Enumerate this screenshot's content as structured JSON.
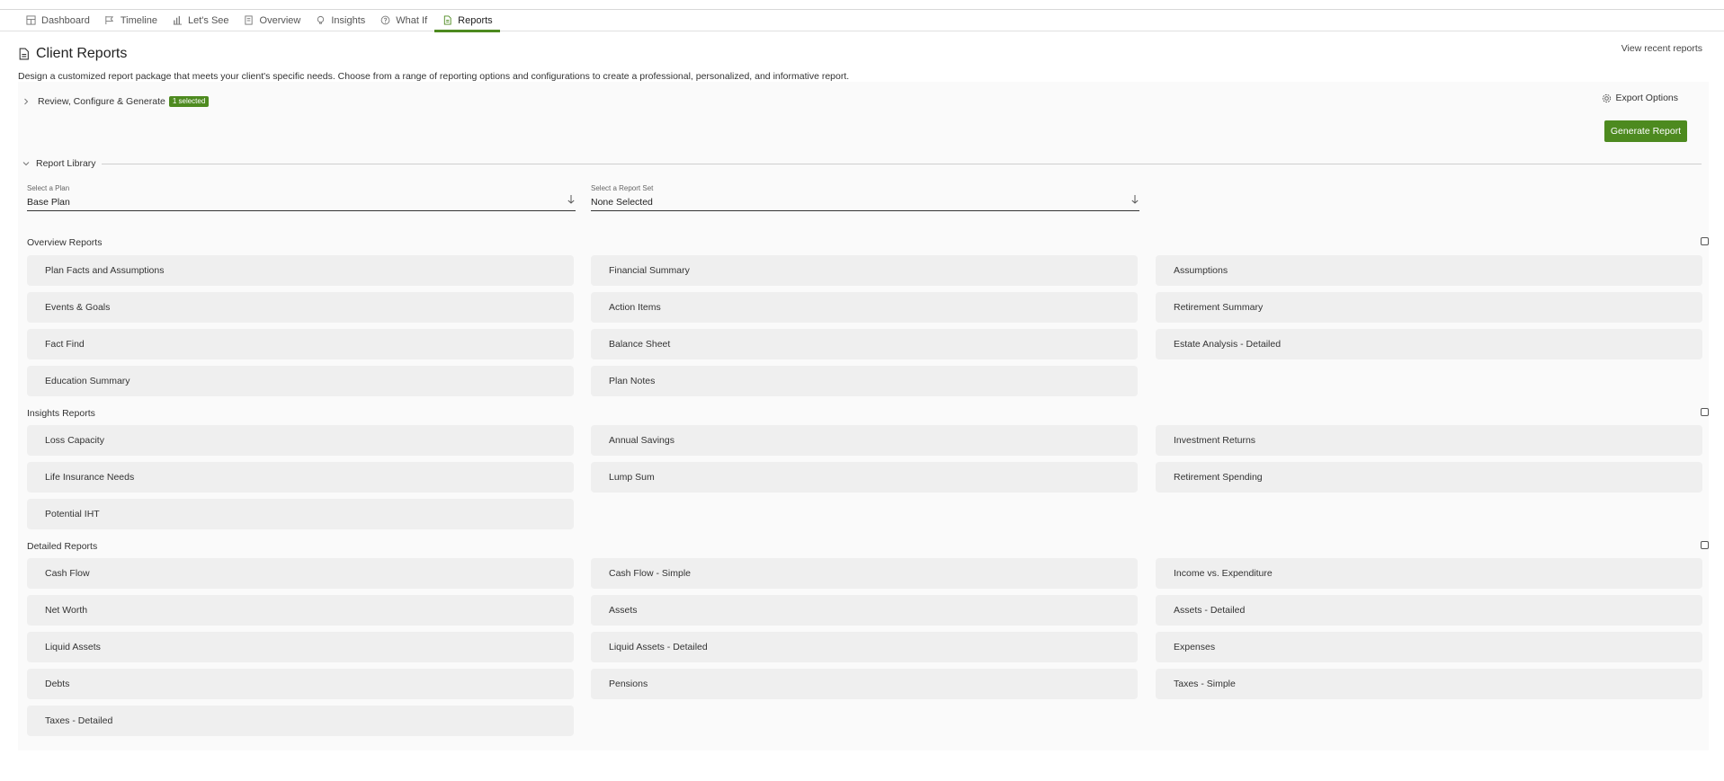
{
  "nav": {
    "tabs": [
      {
        "label": "Dashboard",
        "icon": "dashboard-icon"
      },
      {
        "label": "Timeline",
        "icon": "flag-icon"
      },
      {
        "label": "Let's See",
        "icon": "bar-chart-icon"
      },
      {
        "label": "Overview",
        "icon": "document-icon"
      },
      {
        "label": "Insights",
        "icon": "lightbulb-icon"
      },
      {
        "label": "What If",
        "icon": "question-icon"
      },
      {
        "label": "Reports",
        "icon": "report-icon"
      }
    ],
    "active": "Reports"
  },
  "header": {
    "title": "Client Reports",
    "view_recent": "View recent reports",
    "intro": "Design a customized report package that meets your client's specific needs. Choose from a range of reporting options and configurations to create a professional, personalized, and informative report."
  },
  "review": {
    "label": "Review, Configure & Generate",
    "badge": "1 selected"
  },
  "actions": {
    "export_options": "Export Options",
    "generate_report": "Generate Report"
  },
  "library": {
    "title": "Report Library",
    "plan_select": {
      "label": "Select a Plan",
      "value": "Base Plan"
    },
    "set_select": {
      "label": "Select a Report Set",
      "value": "None Selected"
    }
  },
  "sections": {
    "overview": {
      "title": "Overview Reports",
      "items": [
        "Plan Facts and Assumptions",
        "Financial Summary",
        "Assumptions",
        "Events & Goals",
        "Action Items",
        "Retirement Summary",
        "Fact Find",
        "Balance Sheet",
        "Estate Analysis - Detailed",
        "Education Summary",
        "Plan Notes"
      ]
    },
    "insights": {
      "title": "Insights Reports",
      "items": [
        "Loss Capacity",
        "Annual Savings",
        "Investment Returns",
        "Life Insurance Needs",
        "Lump Sum",
        "Retirement Spending",
        "Potential IHT"
      ]
    },
    "detailed": {
      "title": "Detailed Reports",
      "items": [
        "Cash Flow",
        "Cash Flow - Simple",
        "Income vs. Expenditure",
        "Net Worth",
        "Assets",
        "Assets - Detailed",
        "Liquid Assets",
        "Liquid Assets - Detailed",
        "Expenses",
        "Debts",
        "Pensions",
        "Taxes - Simple",
        "Taxes - Detailed"
      ]
    }
  },
  "colors": {
    "accent": "#4d8a1f",
    "card_bg": "#efefef",
    "panel_bg": "#fafafa"
  }
}
